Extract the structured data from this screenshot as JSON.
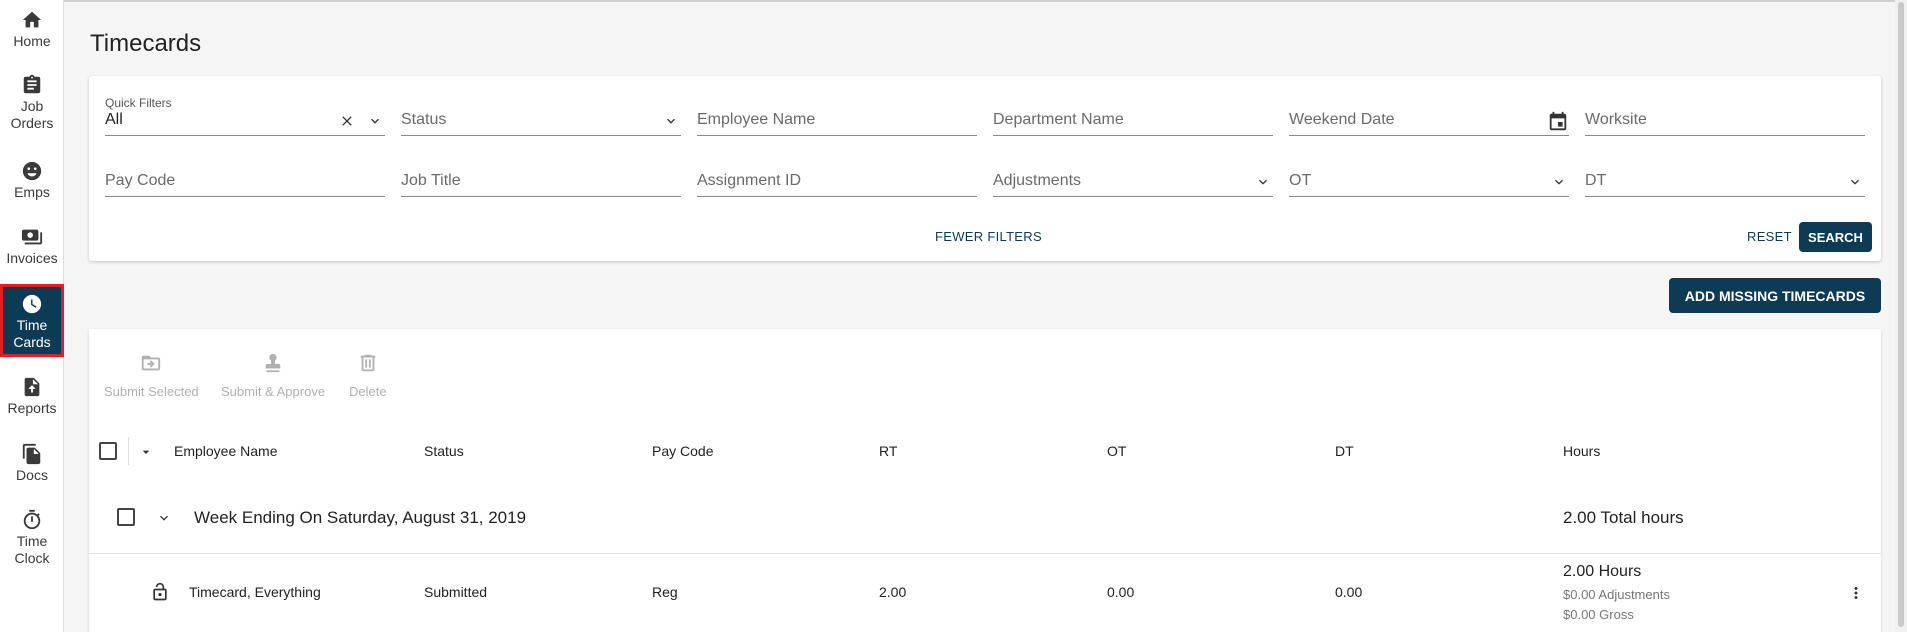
{
  "sidebar": {
    "items": [
      {
        "label": "Home",
        "icon": "home-icon"
      },
      {
        "label": "Job\nOrders",
        "icon": "clipboard-icon"
      },
      {
        "label": "Emps",
        "icon": "people-icon"
      },
      {
        "label": "Invoices",
        "icon": "money-icon"
      },
      {
        "label": "Time\nCards",
        "icon": "clock-icon",
        "active": true
      },
      {
        "label": "Reports",
        "icon": "report-upload-icon"
      },
      {
        "label": "Docs",
        "icon": "documents-icon"
      },
      {
        "label": "Time\nClock",
        "icon": "stopwatch-icon"
      }
    ]
  },
  "page": {
    "title": "Timecards"
  },
  "filters": {
    "quick_filters_label": "Quick Filters",
    "quick_filters_value": "All",
    "status": "Status",
    "employee_name": "Employee Name",
    "department_name": "Department Name",
    "weekend_date": "Weekend Date",
    "worksite": "Worksite",
    "pay_code": "Pay Code",
    "job_title": "Job Title",
    "assignment_id": "Assignment ID",
    "adjustments": "Adjustments",
    "ot": "OT",
    "dt": "DT",
    "fewer_filters": "FEWER FILTERS",
    "reset": "RESET",
    "search": "SEARCH"
  },
  "add_missing": "ADD MISSING TIMECARDS",
  "actions": {
    "submit_selected": "Submit Selected",
    "submit_approve": "Submit & Approve",
    "delete": "Delete"
  },
  "table": {
    "headers": {
      "employee_name": "Employee Name",
      "status": "Status",
      "pay_code": "Pay Code",
      "rt": "RT",
      "ot": "OT",
      "dt": "DT",
      "hours": "Hours"
    },
    "group": {
      "title": "Week Ending On Saturday, August 31, 2019",
      "total": "2.00 Total hours"
    },
    "rows": [
      {
        "employee": "Timecard, Everything",
        "status": "Submitted",
        "pay_code": "Reg",
        "rt": "2.00",
        "ot": "0.00",
        "dt": "0.00",
        "hours": "2.00 Hours",
        "adjustments": "$0.00 Adjustments",
        "gross": "$0.00 Gross"
      }
    ]
  },
  "colors": {
    "primary": "#0d3a55",
    "highlight": "#e11d2a",
    "background": "#f5f5f5"
  }
}
